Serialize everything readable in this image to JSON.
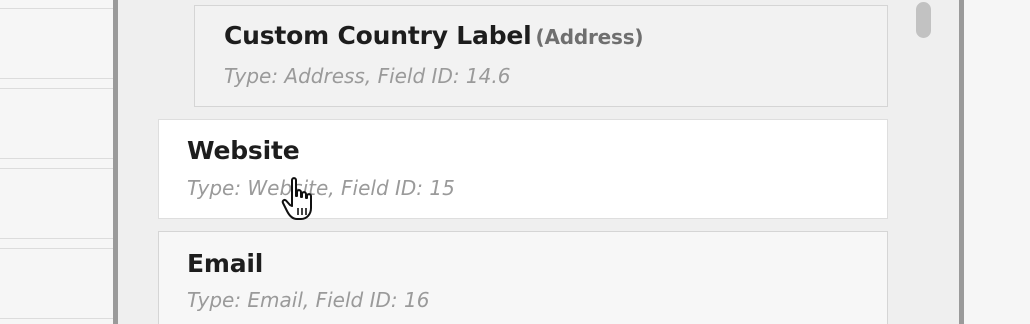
{
  "fields": [
    {
      "label": "Custom Country Label",
      "parent_type": "(Address)",
      "meta": "Type: Address, Field ID: 14.6"
    },
    {
      "label": "Website",
      "meta": "Type: Website, Field ID: 15"
    },
    {
      "label": "Email",
      "meta": "Type: Email, Field ID: 16"
    }
  ],
  "icons": {
    "cursor": "hand-pointer-icon"
  }
}
